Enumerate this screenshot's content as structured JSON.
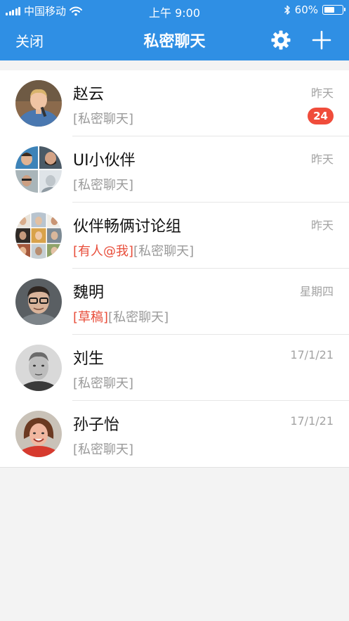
{
  "status_bar": {
    "carrier": "中国移动",
    "time": "上午 9:00",
    "battery": "60%",
    "battery_level": 0.6,
    "icons": [
      "signal-icon",
      "wifi-icon",
      "bluetooth-icon",
      "battery-icon"
    ]
  },
  "nav": {
    "close_label": "关闭",
    "title": "私密聊天",
    "settings_icon": "gear-icon",
    "add_icon": "plus-icon"
  },
  "colors": {
    "header_bg": "#2f8fe4",
    "badge_bg": "#f04c3b",
    "mention_red": "#e84d3a",
    "secondary_text": "#9a9a9a"
  },
  "chats": [
    {
      "name": "赵云",
      "time": "昨天",
      "tag": "",
      "subtitle": "[私密聊天]",
      "badge": "24"
    },
    {
      "name": "UI小伙伴",
      "time": "昨天",
      "tag": "",
      "subtitle": "[私密聊天]",
      "badge": ""
    },
    {
      "name": "伙伴畅俩讨论组",
      "time": "昨天",
      "tag": "[有人@我]",
      "subtitle": "[私密聊天]",
      "badge": ""
    },
    {
      "name": "魏明",
      "time": "星期四",
      "tag": "[草稿]",
      "subtitle": "[私密聊天]",
      "badge": ""
    },
    {
      "name": "刘生",
      "time": "17/1/21",
      "tag": "",
      "subtitle": "[私密聊天]",
      "badge": ""
    },
    {
      "name": "孙子怡",
      "time": "17/1/21",
      "tag": "",
      "subtitle": "[私密聊天]",
      "badge": ""
    }
  ]
}
